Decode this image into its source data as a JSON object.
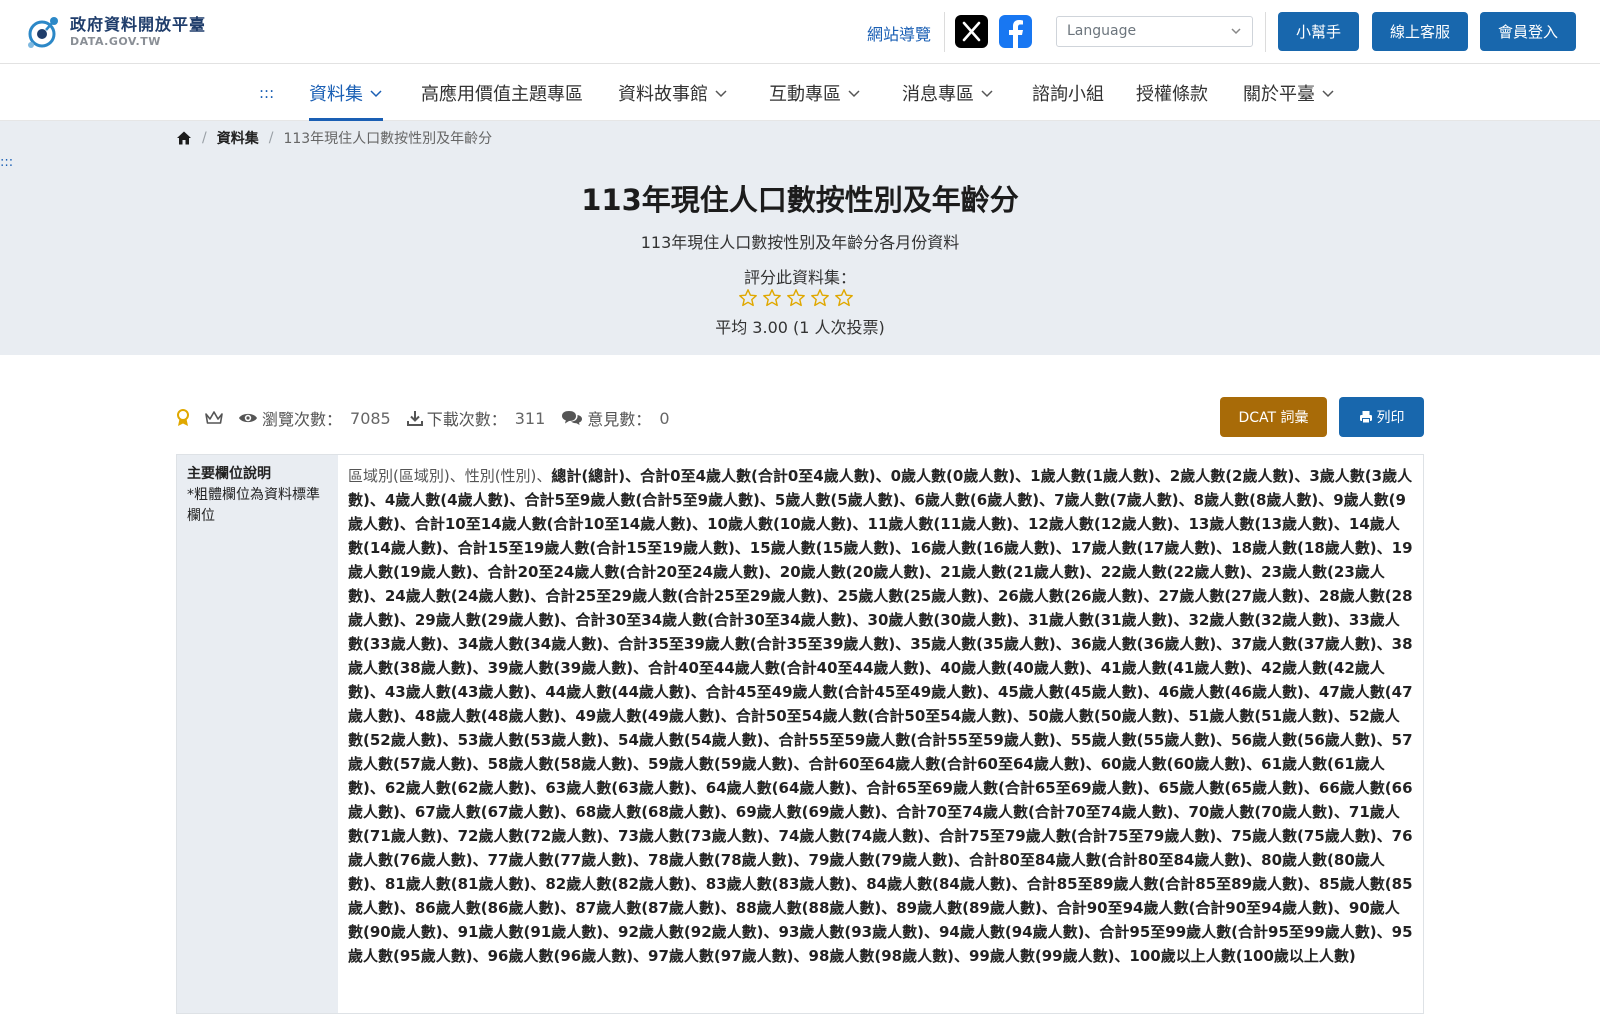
{
  "header": {
    "logo_title": "政府資料開放平臺",
    "logo_subtitle": "DATA.GOV.TW",
    "site_map": "網站導覽",
    "language_placeholder": "Language",
    "helper_btn": "小幫手",
    "service_btn": "線上客服",
    "login_btn": "會員登入"
  },
  "nav": {
    "dots": ":::",
    "items": [
      "資料集",
      "高應用價值主題專區",
      "資料故事館",
      "互動專區",
      "消息專區",
      "諮詢小組",
      "授權條款",
      "關於平臺"
    ]
  },
  "breadcrumb": {
    "dots": ":::",
    "datasets": "資料集",
    "current": "113年現住人口數按性別及年齡分"
  },
  "dataset": {
    "title": "113年現住人口數按性別及年齡分",
    "description": "113年現住人口數按性別及年齡分各月份資料",
    "rate_label": "評分此資料集：",
    "average": "平均 3.00 (1 人次投票)"
  },
  "stats": {
    "views_label": "瀏覽次數：",
    "views": "7085",
    "downloads_label": "下載次數：",
    "downloads": "311",
    "comments_label": "意見數：",
    "comments": "0",
    "dcat_btn": "DCAT 詞彙",
    "print_btn": "列印"
  },
  "fields": {
    "header_title": "主要欄位說明",
    "header_note": "*粗體欄位為資料標準欄位",
    "plain_prefix": "區域別(區域別)、性別(性別)、",
    "bold_list": "總計(總計)、合計0至4歲人數(合計0至4歲人數)、0歲人數(0歲人數)、1歲人數(1歲人數)、2歲人數(2歲人數)、3歲人數(3歲人數)、4歲人數(4歲人數)、合計5至9歲人數(合計5至9歲人數)、5歲人數(5歲人數)、6歲人數(6歲人數)、7歲人數(7歲人數)、8歲人數(8歲人數)、9歲人數(9歲人數)、合計10至14歲人數(合計10至14歲人數)、10歲人數(10歲人數)、11歲人數(11歲人數)、12歲人數(12歲人數)、13歲人數(13歲人數)、14歲人數(14歲人數)、合計15至19歲人數(合計15至19歲人數)、15歲人數(15歲人數)、16歲人數(16歲人數)、17歲人數(17歲人數)、18歲人數(18歲人數)、19歲人數(19歲人數)、合計20至24歲人數(合計20至24歲人數)、20歲人數(20歲人數)、21歲人數(21歲人數)、22歲人數(22歲人數)、23歲人數(23歲人數)、24歲人數(24歲人數)、合計25至29歲人數(合計25至29歲人數)、25歲人數(25歲人數)、26歲人數(26歲人數)、27歲人數(27歲人數)、28歲人數(28歲人數)、29歲人數(29歲人數)、合計30至34歲人數(合計30至34歲人數)、30歲人數(30歲人數)、31歲人數(31歲人數)、32歲人數(32歲人數)、33歲人數(33歲人數)、34歲人數(34歲人數)、合計35至39歲人數(合計35至39歲人數)、35歲人數(35歲人數)、36歲人數(36歲人數)、37歲人數(37歲人數)、38歲人數(38歲人數)、39歲人數(39歲人數)、合計40至44歲人數(合計40至44歲人數)、40歲人數(40歲人數)、41歲人數(41歲人數)、42歲人數(42歲人數)、43歲人數(43歲人數)、44歲人數(44歲人數)、合計45至49歲人數(合計45至49歲人數)、45歲人數(45歲人數)、46歲人數(46歲人數)、47歲人數(47歲人數)、48歲人數(48歲人數)、49歲人數(49歲人數)、合計50至54歲人數(合計50至54歲人數)、50歲人數(50歲人數)、51歲人數(51歲人數)、52歲人數(52歲人數)、53歲人數(53歲人數)、54歲人數(54歲人數)、合計55至59歲人數(合計55至59歲人數)、55歲人數(55歲人數)、56歲人數(56歲人數)、57歲人數(57歲人數)、58歲人數(58歲人數)、59歲人數(59歲人數)、合計60至64歲人數(合計60至64歲人數)、60歲人數(60歲人數)、61歲人數(61歲人數)、62歲人數(62歲人數)、63歲人數(63歲人數)、64歲人數(64歲人數)、合計65至69歲人數(合計65至69歲人數)、65歲人數(65歲人數)、66歲人數(66歲人數)、67歲人數(67歲人數)、68歲人數(68歲人數)、69歲人數(69歲人數)、合計70至74歲人數(合計70至74歲人數)、70歲人數(70歲人數)、71歲人數(71歲人數)、72歲人數(72歲人數)、73歲人數(73歲人數)、74歲人數(74歲人數)、合計75至79歲人數(合計75至79歲人數)、75歲人數(75歲人數)、76歲人數(76歲人數)、77歲人數(77歲人數)、78歲人數(78歲人數)、79歲人數(79歲人數)、合計80至84歲人數(合計80至84歲人數)、80歲人數(80歲人數)、81歲人數(81歲人數)、82歲人數(82歲人數)、83歲人數(83歲人數)、84歲人數(84歲人數)、合計85至89歲人數(合計85至89歲人數)、85歲人數(85歲人數)、86歲人數(86歲人數)、87歲人數(87歲人數)、88歲人數(88歲人數)、89歲人數(89歲人數)、合計90至94歲人數(合計90至94歲人數)、90歲人數(90歲人數)、91歲人數(91歲人數)、92歲人數(92歲人數)、93歲人數(93歲人數)、94歲人數(94歲人數)、合計95至99歲人數(合計95至99歲人數)、95歲人數(95歲人數)、96歲人數(96歲人數)、97歲人數(97歲人數)、98歲人數(98歲人數)、99歲人數(99歲人數)、100歲以上人數(100歲以上人數)"
  },
  "rating": {
    "stars": 5
  },
  "colors": {
    "primary": "#1867ad",
    "dcat": "#a86b08",
    "hero_bg": "#e9edf2",
    "star": "#e0a800"
  },
  "icons": [
    "home-icon",
    "star-icon",
    "eye-icon",
    "download-icon",
    "comments-icon",
    "medal-icon",
    "crown-icon",
    "print-icon",
    "x-icon",
    "facebook-icon",
    "chevron-down-icon"
  ]
}
